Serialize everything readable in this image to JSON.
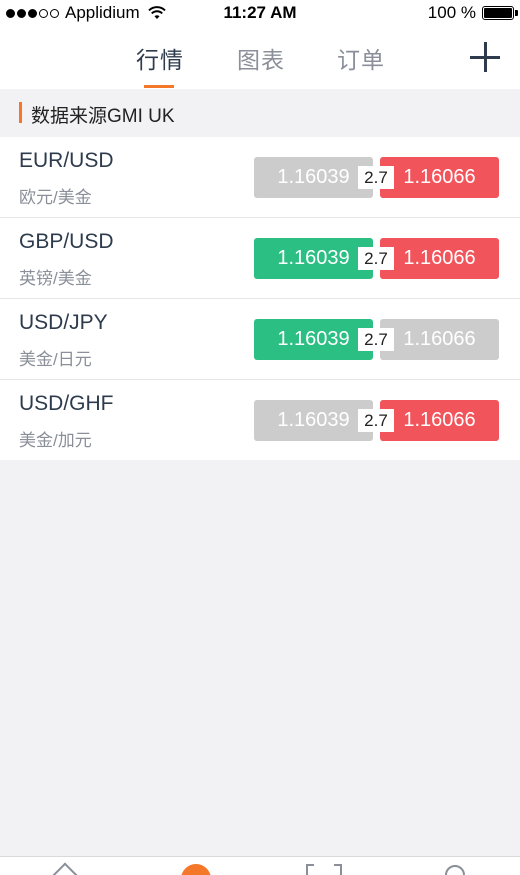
{
  "status": {
    "carrier": "Applidium",
    "time": "11:27 AM",
    "battery": "100 %"
  },
  "nav": {
    "tabs": [
      "行情",
      "图表",
      "订单"
    ],
    "active_tab": 0
  },
  "source": {
    "label": "数据来源GMI UK"
  },
  "quotes": [
    {
      "code": "EUR/USD",
      "name": "欧元/美金",
      "bid": "1.16039",
      "spread": "2.7",
      "ask": "1.16066",
      "bid_color": "gray",
      "ask_color": "red"
    },
    {
      "code": "GBP/USD",
      "name": "英镑/美金",
      "bid": "1.16039",
      "spread": "2.7",
      "ask": "1.16066",
      "bid_color": "green",
      "ask_color": "red"
    },
    {
      "code": "USD/JPY",
      "name": "美金/日元",
      "bid": "1.16039",
      "spread": "2.7",
      "ask": "1.16066",
      "bid_color": "green",
      "ask_color": "gray"
    },
    {
      "code": "USD/GHF",
      "name": "美金/加元",
      "bid": "1.16039",
      "spread": "2.7",
      "ask": "1.16066",
      "bid_color": "gray",
      "ask_color": "red"
    }
  ],
  "colors": {
    "accent": "#f5782a",
    "up": "#2cbf84",
    "down": "#f2545b",
    "neutral": "#cccccc",
    "text_dark": "#2d3b4c"
  },
  "bottom_tabs": {
    "icons": [
      "home-icon",
      "quotes-icon",
      "scan-icon",
      "user-icon"
    ]
  }
}
